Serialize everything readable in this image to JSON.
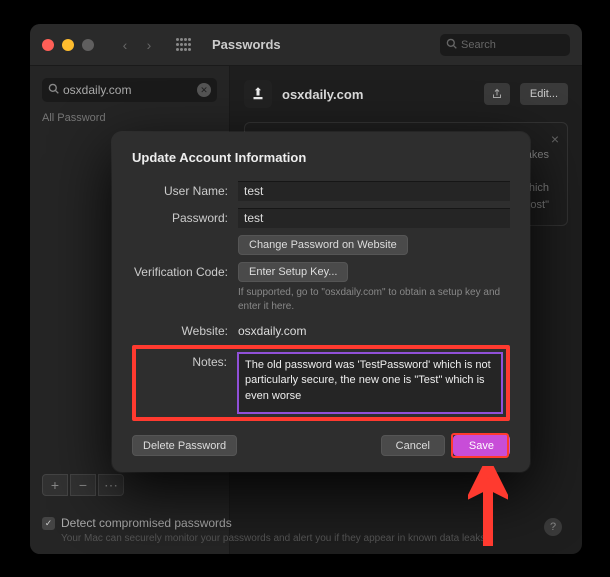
{
  "window": {
    "title": "Passwords",
    "search_placeholder": "Search"
  },
  "sidebar": {
    "search_value": "osxdaily.com",
    "filter_label": "All Password"
  },
  "main": {
    "site_name": "osxdaily.com",
    "edit_label": "Edit...",
    "detail_line1": "makes",
    "detail_line2": "\", which",
    "detail_line3": "host\""
  },
  "footer": {
    "checkbox_label": "Detect compromised passwords",
    "help_text": "Your Mac can securely monitor your passwords and alert you if they appear in known data leaks."
  },
  "dialog": {
    "title": "Update Account Information",
    "labels": {
      "username": "User Name:",
      "password": "Password:",
      "verification": "Verification Code:",
      "website": "Website:",
      "notes": "Notes:"
    },
    "values": {
      "username": "test",
      "password": "test",
      "website": "osxdaily.com",
      "notes": "The old password was 'TestPassword' which is not particularly secure, the new one is \"Test\" which is even worse"
    },
    "buttons": {
      "change_password": "Change Password on Website",
      "setup_key": "Enter Setup Key...",
      "delete": "Delete Password",
      "cancel": "Cancel",
      "save": "Save"
    },
    "hints": {
      "verification": "If supported, go to \"osxdaily.com\" to obtain a setup key and enter it here."
    }
  }
}
